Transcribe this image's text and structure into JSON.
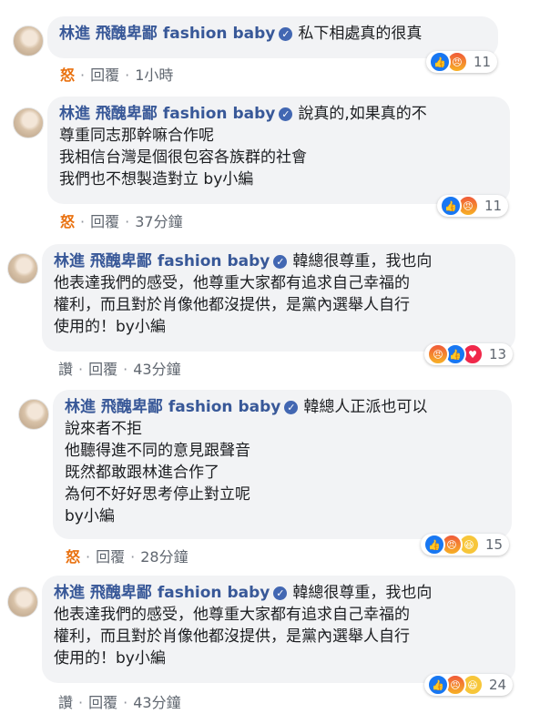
{
  "page_author": "林進 飛醜卑鄙 fashion baby",
  "comments": [
    {
      "first_line": "私下相處真的很真",
      "lines": [],
      "action": "怒",
      "reply": "回覆",
      "time": "1小時",
      "reactions": [
        "like",
        "angry"
      ],
      "count": "11"
    },
    {
      "first_line": "說真的,如果真的不",
      "lines": [
        "尊重同志那幹嘛合作呢",
        "我相信台灣是個很包容各族群的社會",
        "我們也不想製造對立 by小編"
      ],
      "action": "怒",
      "reply": "回覆",
      "time": "37分鐘",
      "reactions": [
        "like",
        "angry"
      ],
      "count": "11"
    },
    {
      "first_line": "韓總很尊重，我也向",
      "lines": [
        "他表達我們的感受，他尊重大家都有追求自己幸福的",
        "權利，而且對於肖像他都沒提供，是黨內選舉人自行",
        "使用的！by小編"
      ],
      "action": "讚",
      "reply": "回覆",
      "time": "43分鐘",
      "reactions": [
        "angry",
        "like",
        "love"
      ],
      "count": "13"
    },
    {
      "first_line": "韓總人正派也可以",
      "lines": [
        "說來者不拒",
        "他聽得進不同的意見跟聲音",
        "既然都敢跟林進合作了",
        "為何不好好思考停止對立呢",
        "by小編"
      ],
      "action": "怒",
      "reply": "回覆",
      "time": "28分鐘",
      "reactions": [
        "like",
        "angry",
        "haha"
      ],
      "count": "15"
    },
    {
      "first_line": "韓總很尊重，我也向",
      "lines": [
        "他表達我們的感受，他尊重大家都有追求自己幸福的",
        "權利，而且對於肖像他都沒提供，是黨內選舉人自行",
        "使用的！by小編"
      ],
      "action": "讚",
      "reply": "回覆",
      "time": "43分鐘",
      "reactions": [
        "like",
        "angry",
        "haha"
      ],
      "count": "24"
    }
  ],
  "icons": {
    "like": "thumbs-up",
    "angry": "angry-face",
    "haha": "laughing-face",
    "love": "heart",
    "verified": "checkmark"
  }
}
